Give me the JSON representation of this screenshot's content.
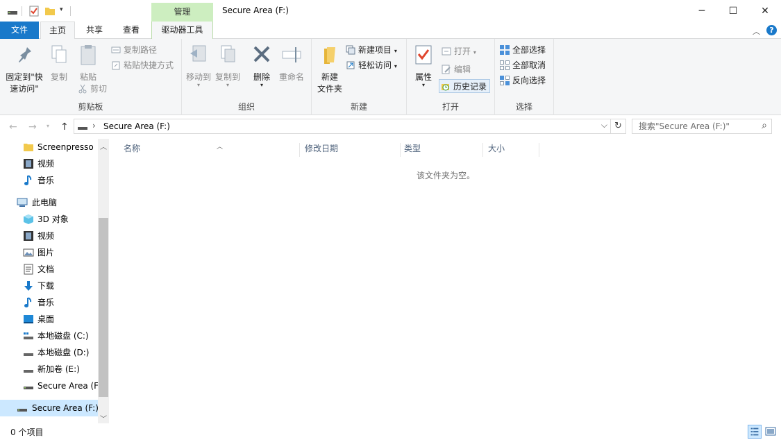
{
  "window": {
    "title": "Secure Area (F:)",
    "contextual_tab": "管理",
    "min_label": "─",
    "max_label": "☐",
    "close_label": "✕"
  },
  "tabs": {
    "file": "文件",
    "home": "主页",
    "share": "共享",
    "view": "查看",
    "drive_tools": "驱动器工具"
  },
  "ribbon": {
    "clipboard": {
      "label": "剪贴板",
      "pin_line1": "固定到\"快",
      "pin_line2": "速访问\"",
      "copy": "复制",
      "paste": "粘贴",
      "copy_path": "复制路径",
      "paste_shortcut": "粘贴快捷方式",
      "cut": "剪切"
    },
    "organize": {
      "label": "组织",
      "move_to": "移动到",
      "copy_to": "复制到",
      "delete": "删除",
      "rename": "重命名"
    },
    "new": {
      "label": "新建",
      "new_folder_line1": "新建",
      "new_folder_line2": "文件夹",
      "new_item": "新建项目",
      "easy_access": "轻松访问"
    },
    "open": {
      "label": "打开",
      "properties": "属性",
      "open": "打开",
      "edit": "编辑",
      "history": "历史记录"
    },
    "select": {
      "label": "选择",
      "select_all": "全部选择",
      "select_none": "全部取消",
      "invert": "反向选择"
    }
  },
  "address": {
    "back": "←",
    "forward": "→",
    "up": "↑",
    "separator": "›",
    "path": "Secure Area (F:)",
    "dropdown": "⌵",
    "refresh": "↻",
    "search_placeholder": "搜索\"Secure Area (F:)\"",
    "search_icon": "⌕"
  },
  "navigation": {
    "items": [
      {
        "label": "Screenpresso",
        "icon": "folder-icon"
      },
      {
        "label": "视频",
        "icon": "video-icon"
      },
      {
        "label": "音乐",
        "icon": "music-icon"
      },
      {
        "label": "此电脑",
        "icon": "computer-icon"
      },
      {
        "label": "3D 对象",
        "icon": "3d-objects-icon"
      },
      {
        "label": "视频",
        "icon": "video-icon"
      },
      {
        "label": "图片",
        "icon": "pictures-icon"
      },
      {
        "label": "文档",
        "icon": "documents-icon"
      },
      {
        "label": "下载",
        "icon": "download-icon"
      },
      {
        "label": "音乐",
        "icon": "music-icon"
      },
      {
        "label": "桌面",
        "icon": "desktop-icon"
      },
      {
        "label": "本地磁盘 (C:)",
        "icon": "drive-icon"
      },
      {
        "label": "本地磁盘 (D:)",
        "icon": "drive-icon"
      },
      {
        "label": "新加卷 (E:)",
        "icon": "drive-icon"
      },
      {
        "label": "Secure Area (F:",
        "icon": "usb-drive-icon"
      },
      {
        "label": "Secure Area (F:)",
        "icon": "usb-drive-icon"
      }
    ]
  },
  "columns": {
    "name": "名称",
    "modified": "修改日期",
    "type": "类型",
    "size": "大小"
  },
  "content": {
    "empty_message": "该文件夹为空。"
  },
  "status": {
    "item_count": "0 个项目"
  },
  "colors": {
    "accent": "#1979ca",
    "contextual": "#cdeec0",
    "selection": "#cce8ff"
  }
}
